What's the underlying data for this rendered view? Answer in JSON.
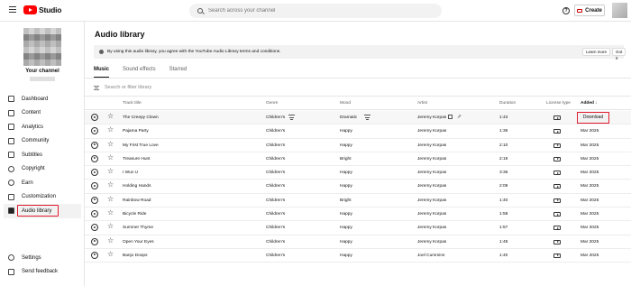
{
  "header": {
    "brand": "Studio",
    "search_placeholder": "Search across your channel",
    "help": "?",
    "create_label": "Create"
  },
  "sidebar": {
    "channel_label": "Your channel",
    "items": [
      {
        "label": "Dashboard",
        "icon": "dashboard-icon"
      },
      {
        "label": "Content",
        "icon": "content-icon"
      },
      {
        "label": "Analytics",
        "icon": "analytics-icon"
      },
      {
        "label": "Community",
        "icon": "community-icon"
      },
      {
        "label": "Subtitles",
        "icon": "subtitles-icon"
      },
      {
        "label": "Copyright",
        "icon": "copyright-icon"
      },
      {
        "label": "Earn",
        "icon": "earn-icon"
      },
      {
        "label": "Customization",
        "icon": "customization-icon"
      },
      {
        "label": "Audio library",
        "icon": "audio-library-icon",
        "active": true
      }
    ],
    "bottom": [
      {
        "label": "Settings",
        "icon": "gear-icon"
      },
      {
        "label": "Send feedback",
        "icon": "feedback-icon"
      }
    ]
  },
  "main": {
    "title": "Audio library",
    "banner": {
      "text": "By using this audio library, you agree with the YouTube Audio Library terms and conditions.",
      "learn_more": "Learn more",
      "got_it": "Got it"
    },
    "tabs": [
      "Music",
      "Sound effects",
      "Starred"
    ],
    "filter_placeholder": "Search or filter library",
    "columns": {
      "title": "Track title",
      "genre": "Genre",
      "mood": "Mood",
      "artist": "Artist",
      "duration": "Duration",
      "license": "License type",
      "added": "Added",
      "sort_arrow": "↓"
    },
    "download_label": "Download",
    "rows": [
      {
        "title": "The Creepy Clown",
        "genre": "Children's",
        "mood": "Dramatic",
        "artist": "Jeremy Korpas",
        "duration": "1:43",
        "added": ""
      },
      {
        "title": "Pajama Party",
        "genre": "Children's",
        "mood": "Happy",
        "artist": "Jeremy Korpas",
        "duration": "1:36",
        "added": "Mar 2025"
      },
      {
        "title": "My First True Love",
        "genre": "Children's",
        "mood": "Happy",
        "artist": "Jeremy Korpas",
        "duration": "2:10",
        "added": "Mar 2025"
      },
      {
        "title": "Treasure Hunt",
        "genre": "Children's",
        "mood": "Bright",
        "artist": "Jeremy Korpas",
        "duration": "2:19",
        "added": "Mar 2025"
      },
      {
        "title": "I Wuv U",
        "genre": "Children's",
        "mood": "Happy",
        "artist": "Jeremy Korpas",
        "duration": "3:36",
        "added": "Mar 2025"
      },
      {
        "title": "Holding Hands",
        "genre": "Children's",
        "mood": "Happy",
        "artist": "Jeremy Korpas",
        "duration": "2:09",
        "added": "Mar 2025"
      },
      {
        "title": "Rainbow Road",
        "genre": "Children's",
        "mood": "Bright",
        "artist": "Jeremy Korpas",
        "duration": "1:40",
        "added": "Mar 2025"
      },
      {
        "title": "Bicycle Ride",
        "genre": "Children's",
        "mood": "Happy",
        "artist": "Jeremy Korpas",
        "duration": "1:58",
        "added": "Mar 2025"
      },
      {
        "title": "Summer Thyme",
        "genre": "Children's",
        "mood": "Happy",
        "artist": "Jeremy Korpas",
        "duration": "1:57",
        "added": "Mar 2025"
      },
      {
        "title": "Open Your Eyes",
        "genre": "Children's",
        "mood": "Happy",
        "artist": "Jeremy Korpas",
        "duration": "1:48",
        "added": "Mar 2025"
      },
      {
        "title": "Banjo Doops",
        "genre": "Children's",
        "mood": "Happy",
        "artist": "Joel Cummins",
        "duration": "1:40",
        "added": "Mar 2025"
      }
    ]
  },
  "colors": {
    "brand_red": "#ff0000",
    "highlight": "#e11d2e"
  }
}
